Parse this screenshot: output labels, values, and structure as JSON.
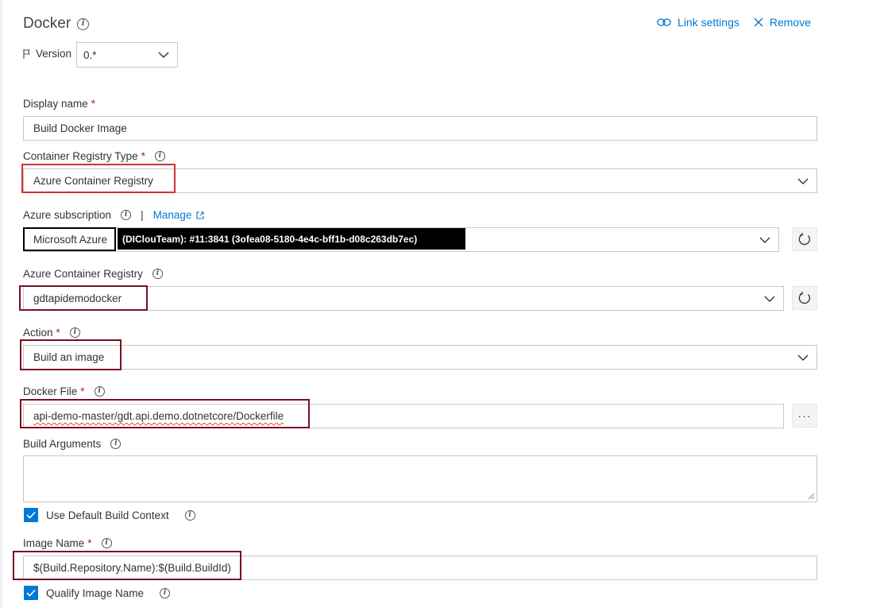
{
  "title": "Docker",
  "header": {
    "link_settings": "Link settings",
    "remove": "Remove"
  },
  "version": {
    "label": "Version",
    "value": "0.*"
  },
  "display_name": {
    "label": "Display name",
    "value": "Build Docker Image"
  },
  "registry_type": {
    "label": "Container Registry Type",
    "value": "Azure Container Registry"
  },
  "subscription": {
    "label": "Azure subscription",
    "manage": "Manage",
    "value": "Microsoft Azure",
    "redacted_text": "(DIClouTeam): #11:3841 (3ofea08-5180-4e4c-bff1b-d08c263db7ec)"
  },
  "acr": {
    "label": "Azure Container Registry",
    "value": "gdtapidemodocker"
  },
  "action": {
    "label": "Action",
    "value": "Build an image"
  },
  "docker_file": {
    "label": "Docker File",
    "value": "api-demo-master/gdt.api.demo.dotnetcore/Dockerfile",
    "browse": "···"
  },
  "build_args": {
    "label": "Build Arguments",
    "value": ""
  },
  "default_context": {
    "label": "Use Default Build Context",
    "checked": true
  },
  "image_name": {
    "label": "Image Name",
    "value": "$(Build.Repository.Name):$(Build.BuildId)"
  },
  "qualify_image": {
    "label": "Qualify Image Name",
    "checked": true
  },
  "required_mark": "*",
  "colors": {
    "accent": "#0078d4",
    "highlight_red": "#d32f2f",
    "highlight_maroon": "#7a0f1e",
    "required": "#a4262c"
  }
}
